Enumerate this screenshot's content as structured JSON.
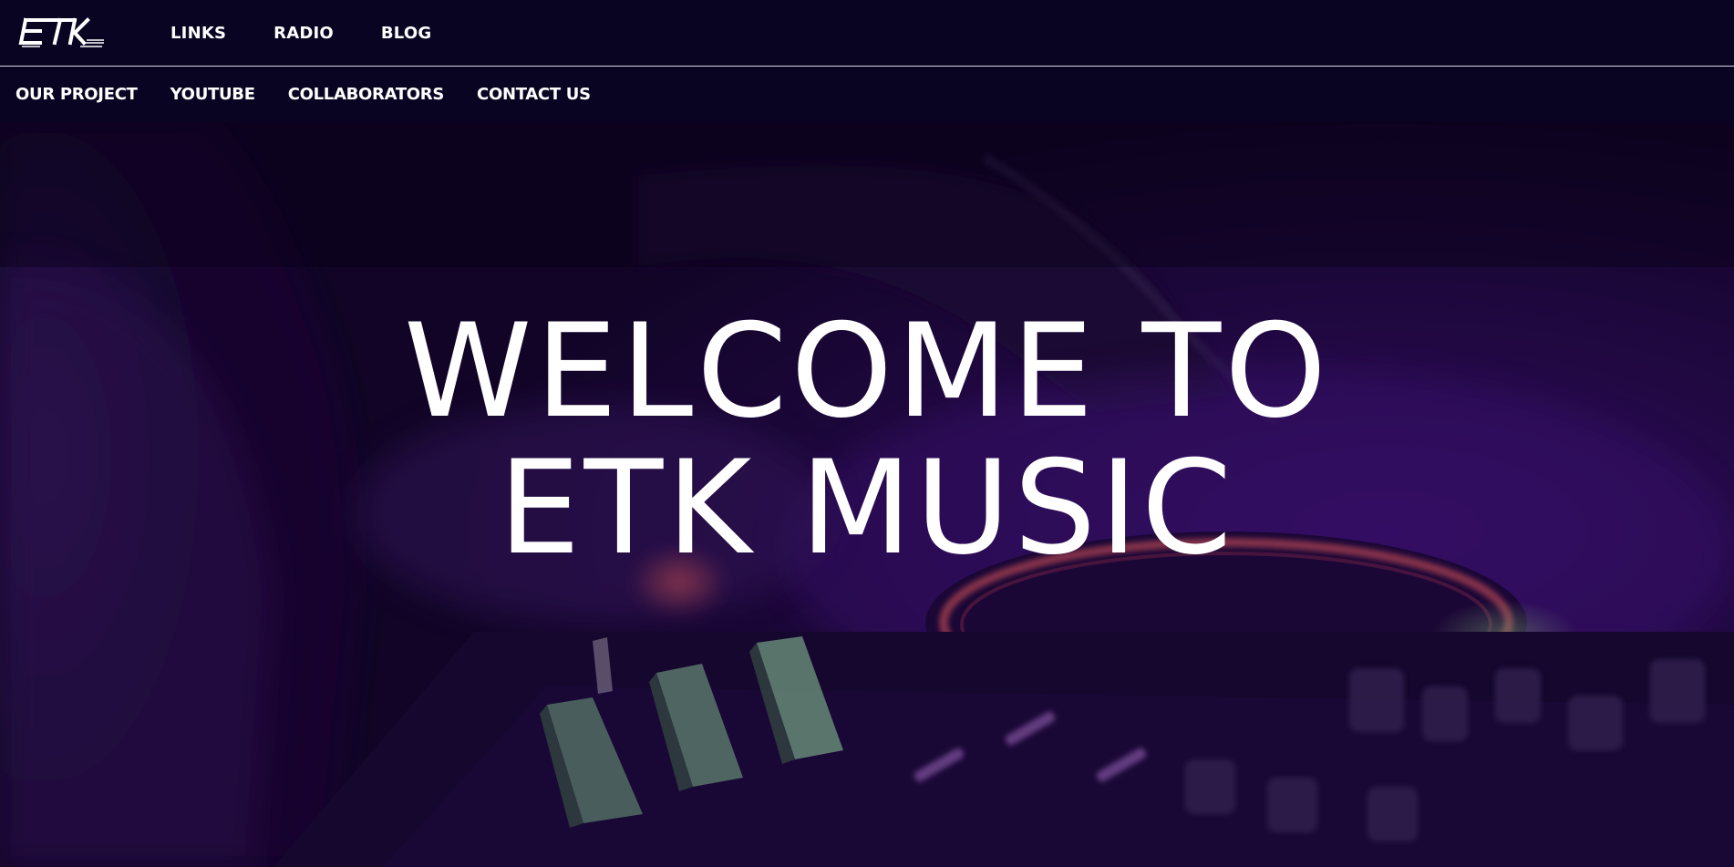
{
  "brand": {
    "logo_text": "ETK"
  },
  "top_nav": {
    "items": [
      {
        "label": "LINKS"
      },
      {
        "label": "RADIO"
      },
      {
        "label": "BLOG"
      }
    ]
  },
  "sub_nav": {
    "items": [
      {
        "label": "OUR PROJECT"
      },
      {
        "label": "YOUTUBE"
      },
      {
        "label": "COLLABORATORS"
      },
      {
        "label": "CONTACT US"
      }
    ]
  },
  "hero": {
    "title_line1": "WELCOME TO",
    "title_line2": "ETK MUSIC"
  },
  "colors": {
    "nav_background": "#0a0423",
    "hero_tint": "#2a0d4d",
    "text": "#ffffff"
  }
}
